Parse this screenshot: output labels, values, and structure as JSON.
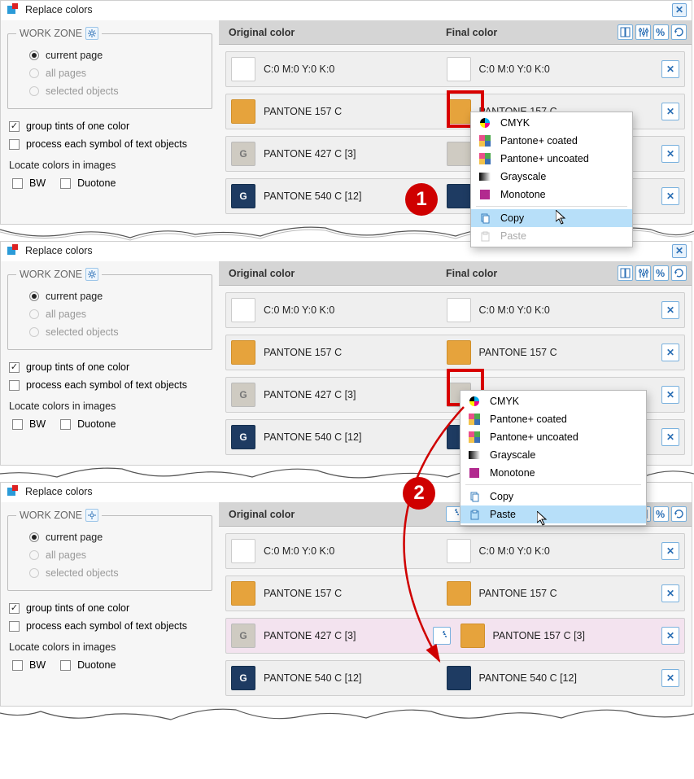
{
  "dialog_title": "Replace colors",
  "workzone": {
    "legend": "WORK ZONE",
    "radios": [
      "current page",
      "all pages",
      "selected objects"
    ],
    "selected": 0
  },
  "checks": {
    "group_tints": "group tints of one color",
    "process_symbols": "process each symbol of text objects"
  },
  "locate_label": "Locate colors in images",
  "locate_bw": "BW",
  "locate_duotone": "Duotone",
  "header": {
    "original": "Original color",
    "final": "Final color"
  },
  "colors": {
    "cmyk0": "C:0 M:0 Y:0 K:0",
    "p157": "PANTONE 157 C",
    "p427_3": "PANTONE 427 C  [3]",
    "p540_12": "PANTONE 540 C  [12]",
    "p157_3": "PANTONE 157 C  [3]"
  },
  "ctx_menu": {
    "cmyk": "CMYK",
    "pantone_coated": "Pantone+ coated",
    "pantone_uncoated": "Pantone+ uncoated",
    "grayscale": "Grayscale",
    "monotone": "Monotone",
    "copy": "Copy",
    "paste": "Paste"
  },
  "badges": {
    "one": "1",
    "two": "2"
  }
}
